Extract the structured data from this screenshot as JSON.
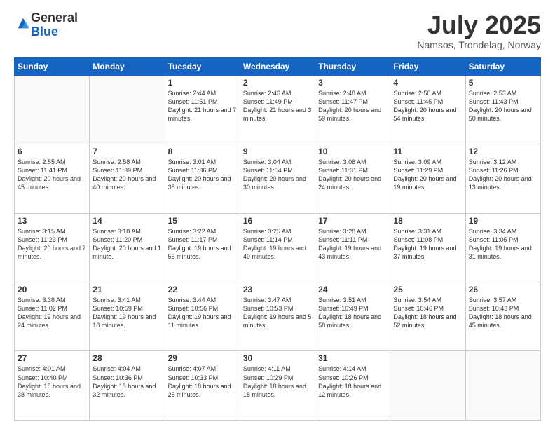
{
  "logo": {
    "general": "General",
    "blue": "Blue"
  },
  "header": {
    "month": "July 2025",
    "subtitle": "Namsos, Trondelag, Norway"
  },
  "weekdays": [
    "Sunday",
    "Monday",
    "Tuesday",
    "Wednesday",
    "Thursday",
    "Friday",
    "Saturday"
  ],
  "weeks": [
    [
      {
        "day": "",
        "info": ""
      },
      {
        "day": "",
        "info": ""
      },
      {
        "day": "1",
        "info": "Sunrise: 2:44 AM\nSunset: 11:51 PM\nDaylight: 21 hours and 7 minutes."
      },
      {
        "day": "2",
        "info": "Sunrise: 2:46 AM\nSunset: 11:49 PM\nDaylight: 21 hours and 3 minutes."
      },
      {
        "day": "3",
        "info": "Sunrise: 2:48 AM\nSunset: 11:47 PM\nDaylight: 20 hours and 59 minutes."
      },
      {
        "day": "4",
        "info": "Sunrise: 2:50 AM\nSunset: 11:45 PM\nDaylight: 20 hours and 54 minutes."
      },
      {
        "day": "5",
        "info": "Sunrise: 2:53 AM\nSunset: 11:43 PM\nDaylight: 20 hours and 50 minutes."
      }
    ],
    [
      {
        "day": "6",
        "info": "Sunrise: 2:55 AM\nSunset: 11:41 PM\nDaylight: 20 hours and 45 minutes."
      },
      {
        "day": "7",
        "info": "Sunrise: 2:58 AM\nSunset: 11:39 PM\nDaylight: 20 hours and 40 minutes."
      },
      {
        "day": "8",
        "info": "Sunrise: 3:01 AM\nSunset: 11:36 PM\nDaylight: 20 hours and 35 minutes."
      },
      {
        "day": "9",
        "info": "Sunrise: 3:04 AM\nSunset: 11:34 PM\nDaylight: 20 hours and 30 minutes."
      },
      {
        "day": "10",
        "info": "Sunrise: 3:06 AM\nSunset: 11:31 PM\nDaylight: 20 hours and 24 minutes."
      },
      {
        "day": "11",
        "info": "Sunrise: 3:09 AM\nSunset: 11:29 PM\nDaylight: 20 hours and 19 minutes."
      },
      {
        "day": "12",
        "info": "Sunrise: 3:12 AM\nSunset: 11:26 PM\nDaylight: 20 hours and 13 minutes."
      }
    ],
    [
      {
        "day": "13",
        "info": "Sunrise: 3:15 AM\nSunset: 11:23 PM\nDaylight: 20 hours and 7 minutes."
      },
      {
        "day": "14",
        "info": "Sunrise: 3:18 AM\nSunset: 11:20 PM\nDaylight: 20 hours and 1 minute."
      },
      {
        "day": "15",
        "info": "Sunrise: 3:22 AM\nSunset: 11:17 PM\nDaylight: 19 hours and 55 minutes."
      },
      {
        "day": "16",
        "info": "Sunrise: 3:25 AM\nSunset: 11:14 PM\nDaylight: 19 hours and 49 minutes."
      },
      {
        "day": "17",
        "info": "Sunrise: 3:28 AM\nSunset: 11:11 PM\nDaylight: 19 hours and 43 minutes."
      },
      {
        "day": "18",
        "info": "Sunrise: 3:31 AM\nSunset: 11:08 PM\nDaylight: 19 hours and 37 minutes."
      },
      {
        "day": "19",
        "info": "Sunrise: 3:34 AM\nSunset: 11:05 PM\nDaylight: 19 hours and 31 minutes."
      }
    ],
    [
      {
        "day": "20",
        "info": "Sunrise: 3:38 AM\nSunset: 11:02 PM\nDaylight: 19 hours and 24 minutes."
      },
      {
        "day": "21",
        "info": "Sunrise: 3:41 AM\nSunset: 10:59 PM\nDaylight: 19 hours and 18 minutes."
      },
      {
        "day": "22",
        "info": "Sunrise: 3:44 AM\nSunset: 10:56 PM\nDaylight: 19 hours and 11 minutes."
      },
      {
        "day": "23",
        "info": "Sunrise: 3:47 AM\nSunset: 10:53 PM\nDaylight: 19 hours and 5 minutes."
      },
      {
        "day": "24",
        "info": "Sunrise: 3:51 AM\nSunset: 10:49 PM\nDaylight: 18 hours and 58 minutes."
      },
      {
        "day": "25",
        "info": "Sunrise: 3:54 AM\nSunset: 10:46 PM\nDaylight: 18 hours and 52 minutes."
      },
      {
        "day": "26",
        "info": "Sunrise: 3:57 AM\nSunset: 10:43 PM\nDaylight: 18 hours and 45 minutes."
      }
    ],
    [
      {
        "day": "27",
        "info": "Sunrise: 4:01 AM\nSunset: 10:40 PM\nDaylight: 18 hours and 38 minutes."
      },
      {
        "day": "28",
        "info": "Sunrise: 4:04 AM\nSunset: 10:36 PM\nDaylight: 18 hours and 32 minutes."
      },
      {
        "day": "29",
        "info": "Sunrise: 4:07 AM\nSunset: 10:33 PM\nDaylight: 18 hours and 25 minutes."
      },
      {
        "day": "30",
        "info": "Sunrise: 4:11 AM\nSunset: 10:29 PM\nDaylight: 18 hours and 18 minutes."
      },
      {
        "day": "31",
        "info": "Sunrise: 4:14 AM\nSunset: 10:26 PM\nDaylight: 18 hours and 12 minutes."
      },
      {
        "day": "",
        "info": ""
      },
      {
        "day": "",
        "info": ""
      }
    ]
  ]
}
